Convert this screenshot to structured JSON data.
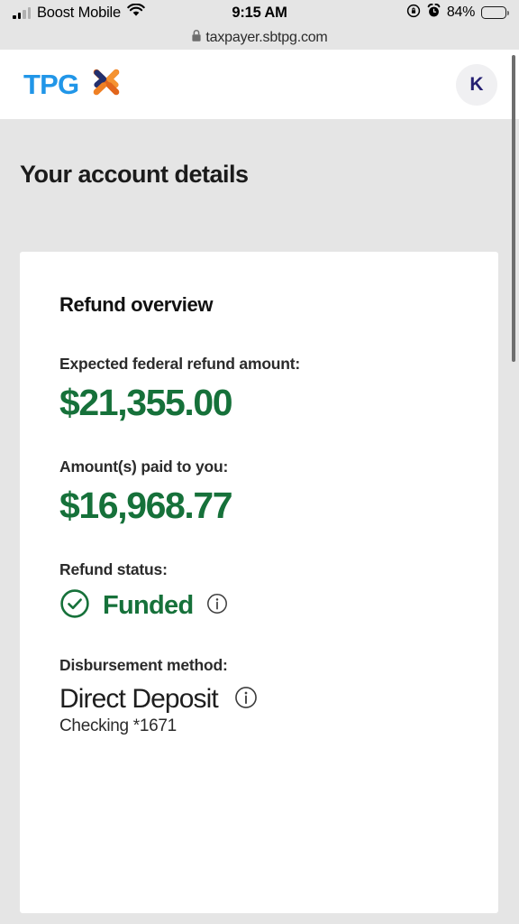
{
  "status_bar": {
    "carrier": "Boost Mobile",
    "time": "9:15 AM",
    "battery_percent": "84%",
    "battery_level": 84,
    "signal_icon": "signal-bars-icon",
    "wifi_icon": "wifi-icon",
    "rotation_lock_icon": "rotation-lock-icon",
    "alarm_icon": "alarm-clock-icon",
    "battery_icon": "battery-icon"
  },
  "browser": {
    "url": "taxpayer.sbtpg.com",
    "lock_icon": "lock-icon"
  },
  "header": {
    "logo_text": "TPG",
    "logo_mark_icon": "tpg-x-mark-icon",
    "avatar_initial": "K"
  },
  "page": {
    "title": "Your account details"
  },
  "card": {
    "title": "Refund overview",
    "fields": {
      "expected_refund_label": "Expected federal refund amount:",
      "expected_refund_value": "$21,355.00",
      "paid_label": "Amount(s) paid to you:",
      "paid_value": "$16,968.77",
      "status_label": "Refund status:",
      "status_value": "Funded",
      "status_check_icon": "check-circle-icon",
      "status_info_icon": "info-icon",
      "method_label": "Disbursement method:",
      "method_value": "Direct Deposit",
      "method_info_icon": "info-icon",
      "method_account": "Checking *1671"
    }
  },
  "colors": {
    "brand_blue": "#2196e8",
    "brand_orange": "#ef8024",
    "brand_navy": "#23306e",
    "success_green": "#16713a",
    "page_background": "#e5e5e5",
    "card_background": "#ffffff"
  },
  "scrollbar": {
    "name": "vertical-scrollbar"
  }
}
